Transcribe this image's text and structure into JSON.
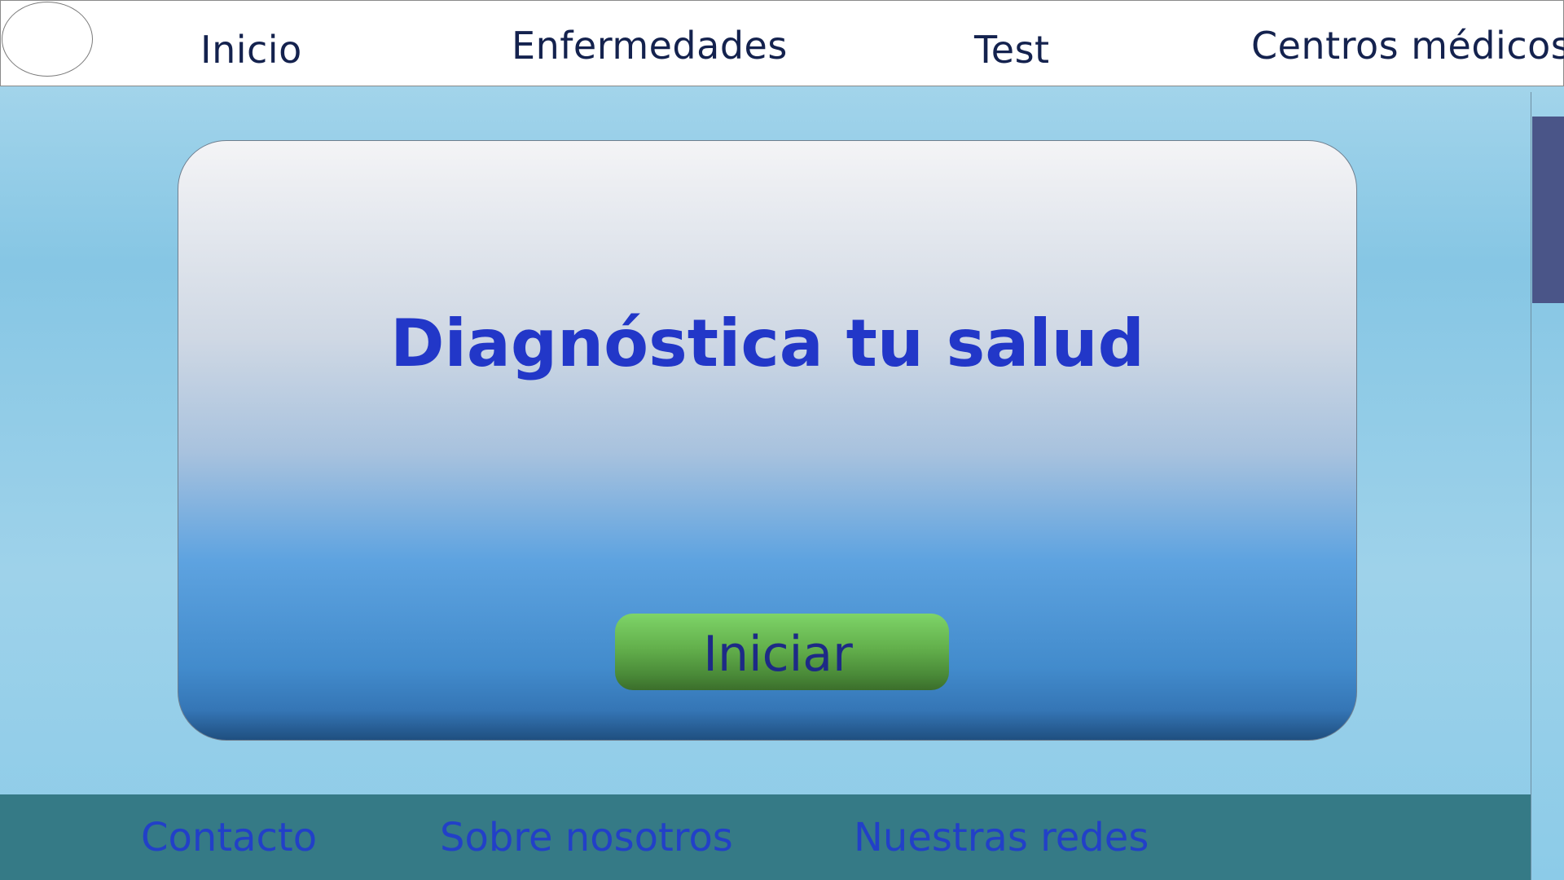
{
  "nav": {
    "items": [
      {
        "label": "Inicio"
      },
      {
        "label": "Enfermedades"
      },
      {
        "label": "Test"
      },
      {
        "label": "Centros médicos"
      }
    ]
  },
  "hero": {
    "title": "Diagnóstica tu salud",
    "start_button_label": "Iniciar"
  },
  "footer": {
    "links": [
      {
        "label": "Contacto"
      },
      {
        "label": "Sobre nosotros"
      },
      {
        "label": "Nuestras redes"
      }
    ]
  },
  "colors": {
    "nav_text": "#14224e",
    "title_text": "#2237c8",
    "button_green": "#63b04c",
    "footer_bg": "#357a86",
    "footer_text": "#2240c8",
    "scroll_thumb": "#4a5588"
  }
}
